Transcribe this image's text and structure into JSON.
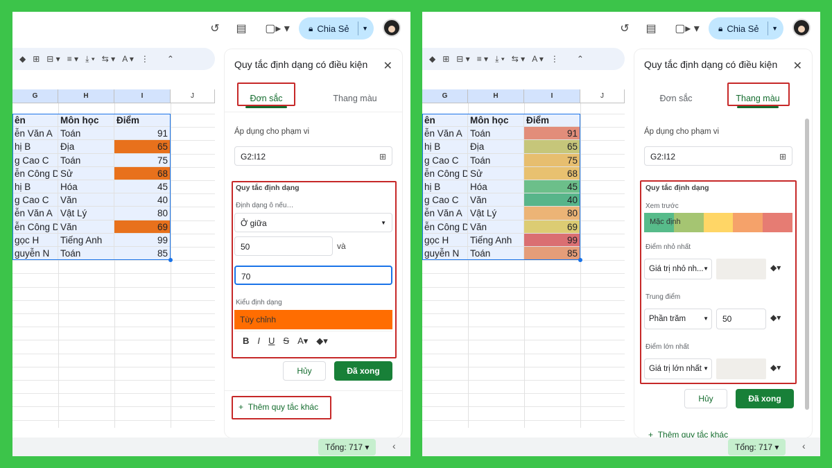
{
  "colors": {
    "bg": "#3cc44a",
    "accent": "#146c2e",
    "highlight": "#e8711c",
    "custom": "#ff6d01",
    "red": "#c62828"
  },
  "topbar": {
    "share_label": "Chia Sẻ",
    "icons": [
      "history-icon",
      "comment-icon",
      "video-icon",
      "lock-icon"
    ]
  },
  "sheet": {
    "columns": [
      "G",
      "H",
      "I",
      "J"
    ],
    "header": [
      "ên",
      "Môn học",
      "Điểm"
    ],
    "rows": [
      [
        "ễn Văn A",
        "Toán",
        "91"
      ],
      [
        "hị B",
        "Địa",
        "65"
      ],
      [
        "g Cao C",
        "Toán",
        "75"
      ],
      [
        "ễn Công D",
        "Sử",
        "68"
      ],
      [
        "hị B",
        "Hóa",
        "45"
      ],
      [
        "g Cao C",
        "Văn",
        "40"
      ],
      [
        "ễn Văn A",
        "Vật Lý",
        "80"
      ],
      [
        "ễn Công D",
        "Văn",
        "69"
      ],
      [
        "gọc H",
        "Tiếng Anh",
        "99"
      ],
      [
        "guyễn N",
        "Toán",
        "85"
      ]
    ],
    "left_highlight": [
      false,
      true,
      false,
      true,
      false,
      false,
      false,
      true,
      false,
      false
    ],
    "right_colors": [
      "#e28d7a",
      "#c6c67a",
      "#e7be6f",
      "#e8c170",
      "#6cbf8a",
      "#58b58a",
      "#ecb476",
      "#dccc73",
      "#da6f72",
      "#e59d79"
    ]
  },
  "sum_label": "Tổng: 717",
  "left": {
    "title": "Quy tắc định dạng có điều kiện",
    "tab1": "Đơn sắc",
    "tab2": "Thang màu",
    "range_label": "Áp dụng cho phạm vi",
    "range": "G2:I12",
    "rules_label": "Quy tắc định dạng",
    "cond_label": "Định dạng ô nếu…",
    "cond_value": "Ở giữa",
    "v1": "50",
    "and": "và",
    "v2": "70",
    "style_label": "Kiểu định dạng",
    "style_value": "Tùy chỉnh",
    "cancel": "Hủy",
    "done": "Đã xong",
    "add": "Thêm quy tắc khác"
  },
  "right": {
    "title": "Quy tắc định dạng có điều kiện",
    "tab1": "Đơn sắc",
    "tab2": "Thang màu",
    "range_label": "Áp dụng cho phạm vi",
    "range": "G2:I12",
    "rules_label": "Quy tắc định dạng",
    "preview_label": "Xem trước",
    "preview_text": "Mặc định",
    "preview_colors": [
      "#57bb8a",
      "#a5c572",
      "#ffd666",
      "#f5a26a",
      "#e67c73"
    ],
    "min_label": "Điểm nhỏ nhất",
    "min_value": "Giá trị nhỏ nh...",
    "mid_label": "Trung điểm",
    "mid_value": "Phần trăm",
    "mid_num": "50",
    "max_label": "Điểm lớn nhất",
    "max_value": "Giá trị lớn nhất",
    "cancel": "Hủy",
    "done": "Đã xong",
    "add": "Thêm quy tắc khác"
  }
}
